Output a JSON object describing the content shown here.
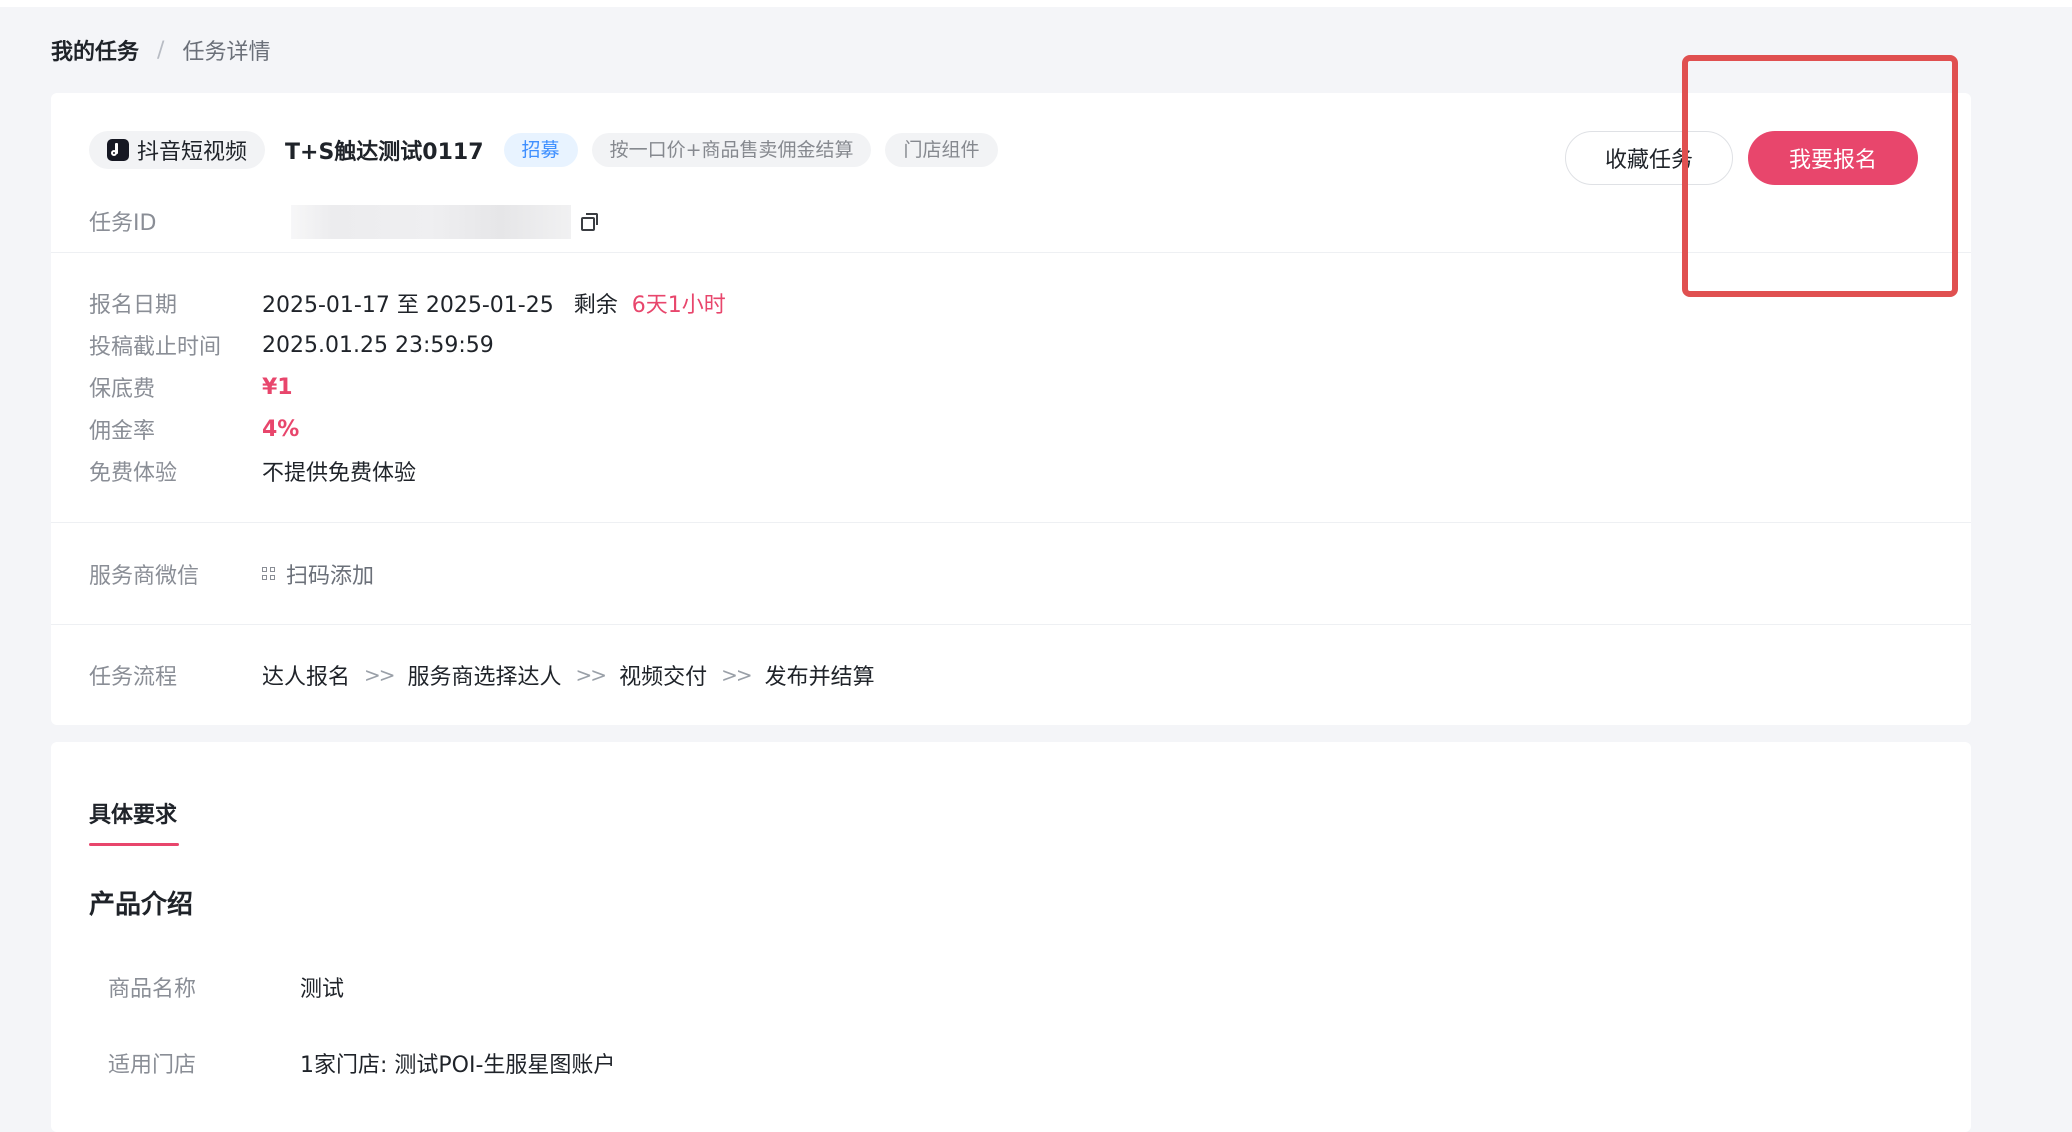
{
  "breadcrumb": {
    "home": "我的任务",
    "separator": "/",
    "current": "任务详情"
  },
  "task": {
    "platform": "抖音短视频",
    "name": "T+S触达测试0117",
    "tags": [
      "招募",
      "按一口价+商品售卖佣金结算",
      "门店组件"
    ],
    "id_label": "任务ID"
  },
  "actions": {
    "favorite": "收藏任务",
    "apply": "我要报名"
  },
  "info": {
    "signup_date": {
      "label": "报名日期",
      "value": "2025-01-17 至 2025-01-25",
      "remain_label": "剩余",
      "remain_value": "6天1小时"
    },
    "deadline": {
      "label": "投稿截止时间",
      "value": "2025.01.25 23:59:59"
    },
    "base_fee": {
      "label": "保底费",
      "value": "¥1"
    },
    "commission": {
      "label": "佣金率",
      "value": "4%"
    },
    "free_trial": {
      "label": "免费体验",
      "value": "不提供免费体验"
    },
    "wechat": {
      "label": "服务商微信",
      "value": "扫码添加"
    },
    "flow": {
      "label": "任务流程",
      "steps": [
        "达人报名",
        "服务商选择达人",
        "视频交付",
        "发布并结算"
      ],
      "separator": ">>"
    }
  },
  "requirements": {
    "tab": "具体要求",
    "section_title": "产品介绍",
    "product_name": {
      "label": "商品名称",
      "value": "测试"
    },
    "stores": {
      "label": "适用门店",
      "value": "1家门店: 测试POI-生服星图账户"
    }
  },
  "colors": {
    "accent": "#e8466c",
    "highlight": "#e05050",
    "tag_blue": "#3e8fff"
  }
}
